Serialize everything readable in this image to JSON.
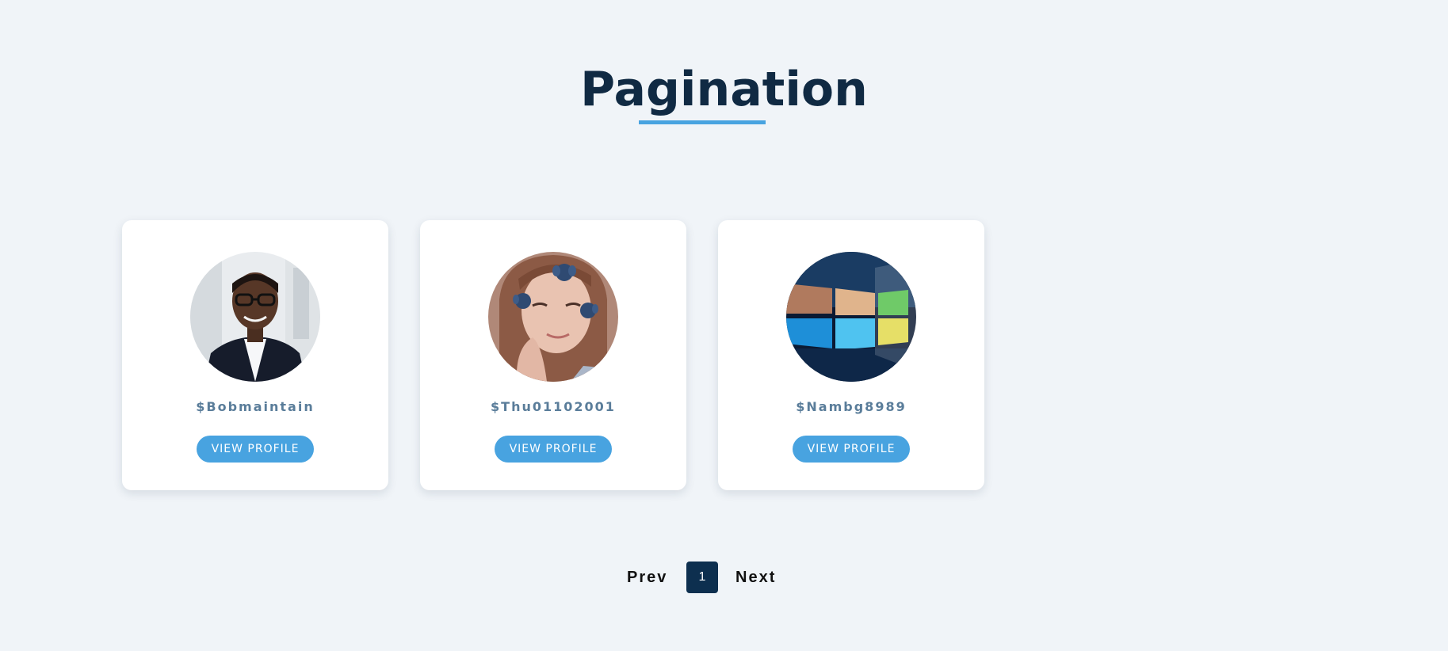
{
  "header": {
    "title": "Pagination"
  },
  "cards": [
    {
      "username": "$Bobmaintain",
      "button_label": "VIEW PROFILE",
      "avatar_icon": "person-portrait-photo"
    },
    {
      "username": "$Thu01102001",
      "button_label": "VIEW PROFILE",
      "avatar_icon": "person-portrait-photo"
    },
    {
      "username": "$Nambg8989",
      "button_label": "VIEW PROFILE",
      "avatar_icon": "windows-logo-wallpaper"
    }
  ],
  "pagination": {
    "prev_label": "Prev",
    "current_page": "1",
    "next_label": "Next"
  },
  "colors": {
    "background": "#f0f4f8",
    "title": "#102a43",
    "accent": "#48a3e0",
    "username": "#5a7d9a",
    "active_page": "#0d2f4f"
  }
}
